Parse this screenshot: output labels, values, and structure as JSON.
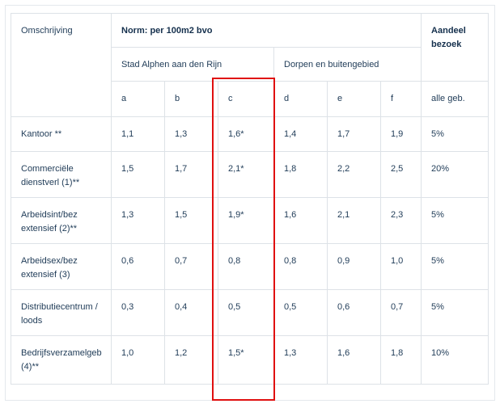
{
  "header": {
    "description": "Omschrijving",
    "norm": "Norm: per 100m2 bvo",
    "share": "Aandeel bezoek",
    "city": "Stad Alphen aan den Rijn",
    "villages": "Dorpen en buitengebied",
    "cols": [
      "a",
      "b",
      "c",
      "d",
      "e",
      "f"
    ],
    "all_areas": "alle geb."
  },
  "rows": [
    {
      "label": "Kantoor **",
      "values": [
        "1,1",
        "1,3",
        "1,6*",
        "1,4",
        "1,7",
        "1,9"
      ],
      "share": "5%"
    },
    {
      "label": "Commerciële dienstverl (1)**",
      "values": [
        "1,5",
        "1,7",
        "2,1*",
        "1,8",
        "2,2",
        "2,5"
      ],
      "share": "20%"
    },
    {
      "label": "Arbeidsint/bez extensief (2)**",
      "values": [
        "1,3",
        "1,5",
        "1,9*",
        "1,6",
        "2,1",
        "2,3"
      ],
      "share": "5%"
    },
    {
      "label": "Arbeidsex/bez extensief (3)",
      "values": [
        "0,6",
        "0,7",
        "0,8",
        "0,8",
        "0,9",
        "1,0"
      ],
      "share": "5%"
    },
    {
      "label": "Distributiecentrum / loods",
      "values": [
        "0,3",
        "0,4",
        "0,5",
        "0,5",
        "0,6",
        "0,7"
      ],
      "share": "5%"
    },
    {
      "label": "Bedrijfsverzamelgeb (4)**",
      "values": [
        "1,0",
        "1,2",
        "1,5*",
        "1,3",
        "1,6",
        "1,8"
      ],
      "share": "10%"
    }
  ],
  "colors": {
    "text": "#1f3b57",
    "border": "#dde2e7",
    "highlight": "#e01010"
  }
}
